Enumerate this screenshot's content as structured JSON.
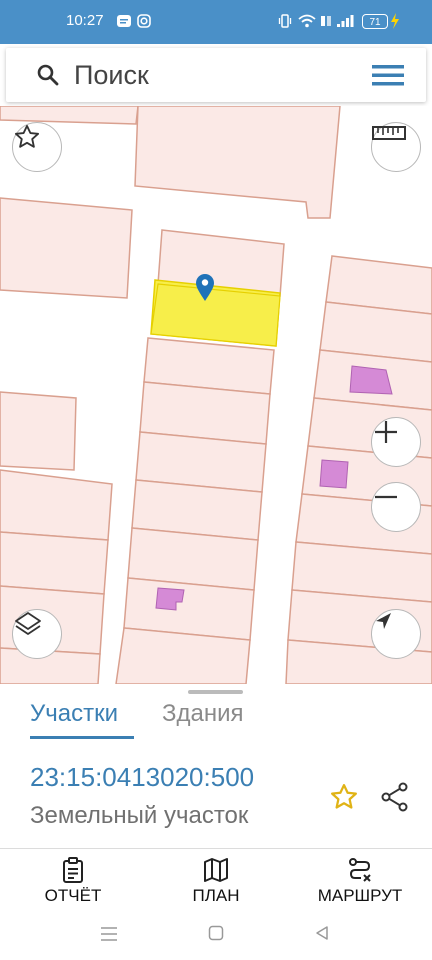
{
  "status_bar": {
    "time": "10:27",
    "battery_level": "71"
  },
  "search": {
    "placeholder": "Поиск"
  },
  "map": {
    "marker_icon": "location-pin-icon",
    "highlight_color": "#f7ee4a",
    "parcel_fill": "#fbe9e6",
    "parcel_stroke": "#d9a08f",
    "building_fill": "#d58ad6"
  },
  "tabs": {
    "parcels": "Участки",
    "buildings": "Здания"
  },
  "parcel": {
    "cadastral_number": "23:15:0413020:500",
    "type": "Земельный участок"
  },
  "bottom_nav": {
    "report": "ОТЧЁТ",
    "plan": "ПЛАН",
    "route": "МАРШРУТ"
  },
  "colors": {
    "accent": "#3b7fb3",
    "status_bar": "#4a90c8",
    "favorite_star": "#e0b316"
  }
}
